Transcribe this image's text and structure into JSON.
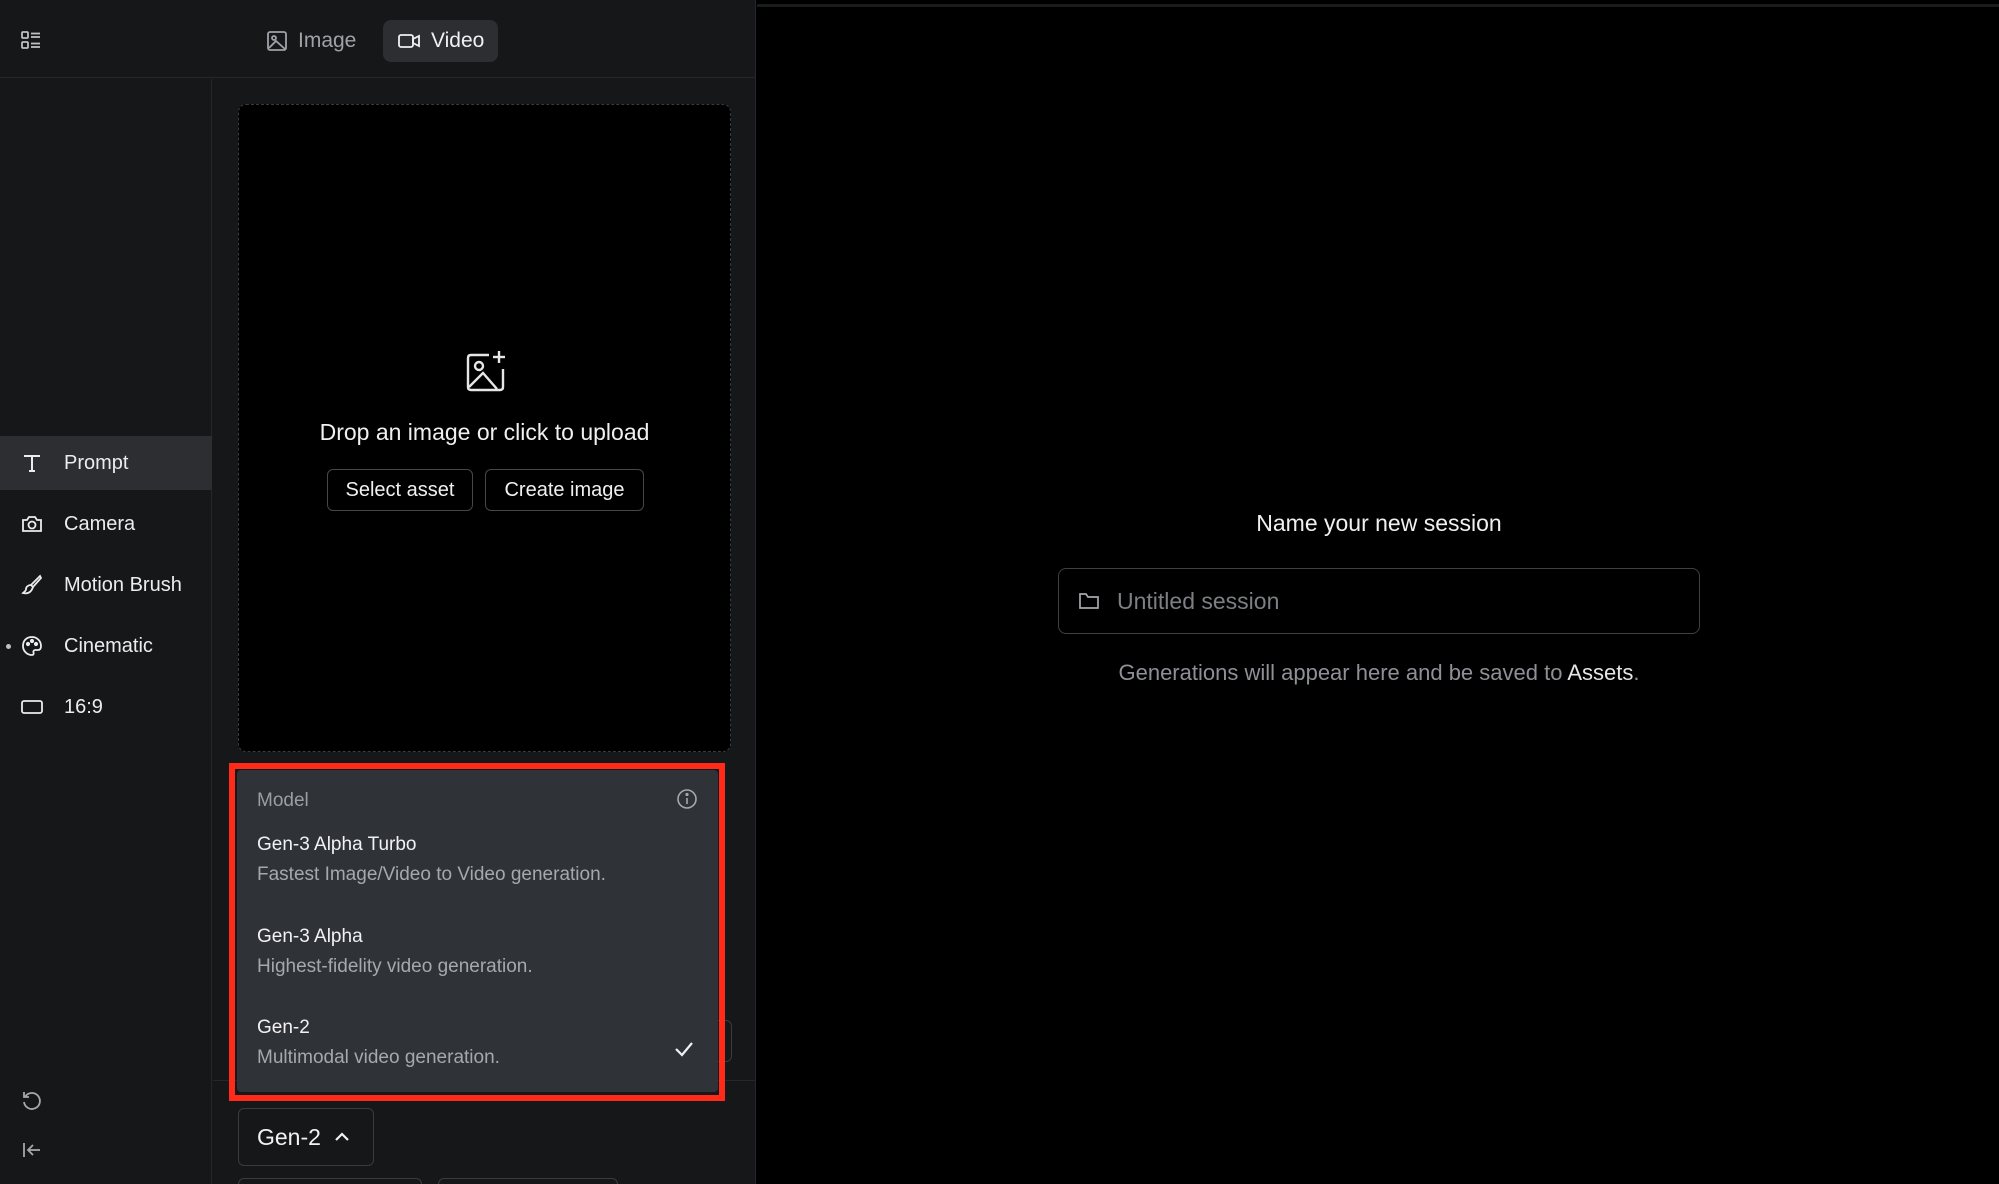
{
  "header": {
    "tabs": [
      {
        "label": "Image",
        "icon": "image-icon",
        "active": false
      },
      {
        "label": "Video",
        "icon": "video-camera-icon",
        "active": true
      }
    ]
  },
  "sidebar": {
    "items": [
      {
        "label": "Prompt",
        "icon": "text-icon",
        "active": true
      },
      {
        "label": "Camera",
        "icon": "camera-icon"
      },
      {
        "label": "Motion Brush",
        "icon": "brush-icon"
      },
      {
        "label": "Cinematic",
        "icon": "palette-icon",
        "has_dot": true
      },
      {
        "label": "16:9",
        "icon": "aspect-ratio-icon"
      }
    ]
  },
  "upload": {
    "text": "Drop an image or click to upload",
    "select_label": "Select asset",
    "create_label": "Create image"
  },
  "model_menu": {
    "header": "Model",
    "options": [
      {
        "name": "Gen-3 Alpha Turbo",
        "description": "Fastest Image/Video to Video generation.",
        "selected": false
      },
      {
        "name": "Gen-3 Alpha",
        "description": "Highest-fidelity video generation.",
        "selected": false
      },
      {
        "name": "Gen-2",
        "description": "Multimodal video generation.",
        "selected": true
      }
    ],
    "highlight_color": "#ff2a17"
  },
  "model_select": {
    "value": "Gen-2"
  },
  "session": {
    "title": "Name your new session",
    "placeholder": "Untitled session",
    "hint_prefix": "Generations will appear here and be saved to ",
    "hint_link": "Assets",
    "hint_suffix": "."
  },
  "colors": {
    "background": "#000000",
    "panel": "#161719",
    "active": "#2c2e32",
    "menu": "#2f3237"
  }
}
